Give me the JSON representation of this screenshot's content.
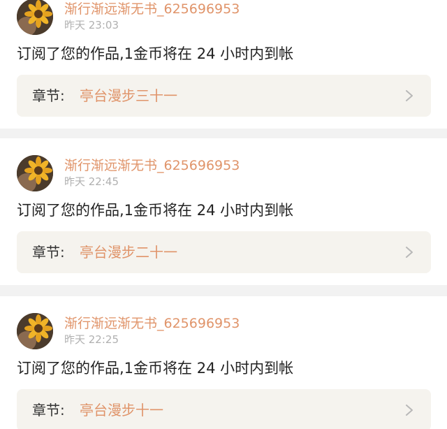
{
  "notifications": [
    {
      "username": "渐行渐远渐无书_625696953",
      "time": "昨天 23:03",
      "message": "订阅了您的作品,1金币将在 24 小时内到帐",
      "chapter_prefix": "章节:",
      "chapter_title": "亭台漫步三十一",
      "avatar_icon": "sunflower-avatar",
      "chevron_icon": "chevron-right-icon"
    },
    {
      "username": "渐行渐远渐无书_625696953",
      "time": "昨天 22:45",
      "message": "订阅了您的作品,1金币将在 24 小时内到帐",
      "chapter_prefix": "章节:",
      "chapter_title": "亭台漫步二十一",
      "avatar_icon": "sunflower-avatar",
      "chevron_icon": "chevron-right-icon"
    },
    {
      "username": "渐行渐远渐无书_625696953",
      "time": "昨天 22:25",
      "message": "订阅了您的作品,1金币将在 24 小时内到帐",
      "chapter_prefix": "章节:",
      "chapter_title": "亭台漫步十一",
      "avatar_icon": "sunflower-avatar",
      "chevron_icon": "chevron-right-icon"
    }
  ],
  "colors": {
    "username": "#e0946a",
    "chapter_title": "#e0946a",
    "time": "#b0b0b0",
    "message": "#222222",
    "chapter_box_bg": "#f5f3ee",
    "divider": "#f2f2f2"
  }
}
